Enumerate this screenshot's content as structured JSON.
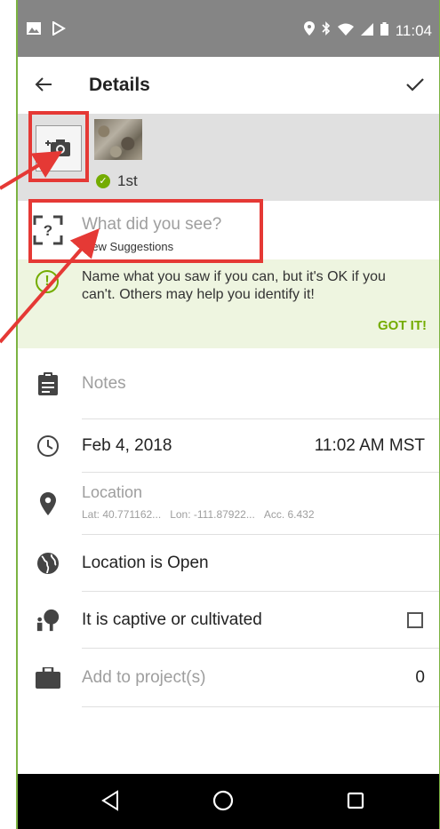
{
  "status_bar": {
    "time": "11:04",
    "left_icons": [
      "image-icon",
      "play-store-icon"
    ],
    "right_icons": [
      "location-icon",
      "bluetooth-icon",
      "wifi-icon",
      "signal-icon",
      "battery-icon"
    ]
  },
  "app_bar": {
    "title": "Details"
  },
  "photo": {
    "badge_label": "1st"
  },
  "taxon": {
    "placeholder": "What did you see?",
    "suggestions_link": "View Suggestions"
  },
  "tip": {
    "text": "Name what you saw if you can, but it's OK if you can't. Others may help you identify it!",
    "action": "GOT IT!"
  },
  "notes": {
    "placeholder": "Notes"
  },
  "date_row": {
    "date": "Feb 4, 2018",
    "time": "11:02 AM MST"
  },
  "location_row": {
    "title": "Location",
    "lat": "Lat: 40.771162...",
    "lon": "Lon: -111.87922...",
    "acc": "Acc. 6.432"
  },
  "geoprivacy_row": {
    "label": "Location is Open"
  },
  "captive_row": {
    "label": "It is captive or cultivated",
    "checked": false
  },
  "projects_row": {
    "label": "Add to project(s)",
    "count": "0"
  },
  "colors": {
    "accent_green": "#74ac00",
    "highlight_red": "#e53935",
    "tip_background": "#eef5e0"
  }
}
